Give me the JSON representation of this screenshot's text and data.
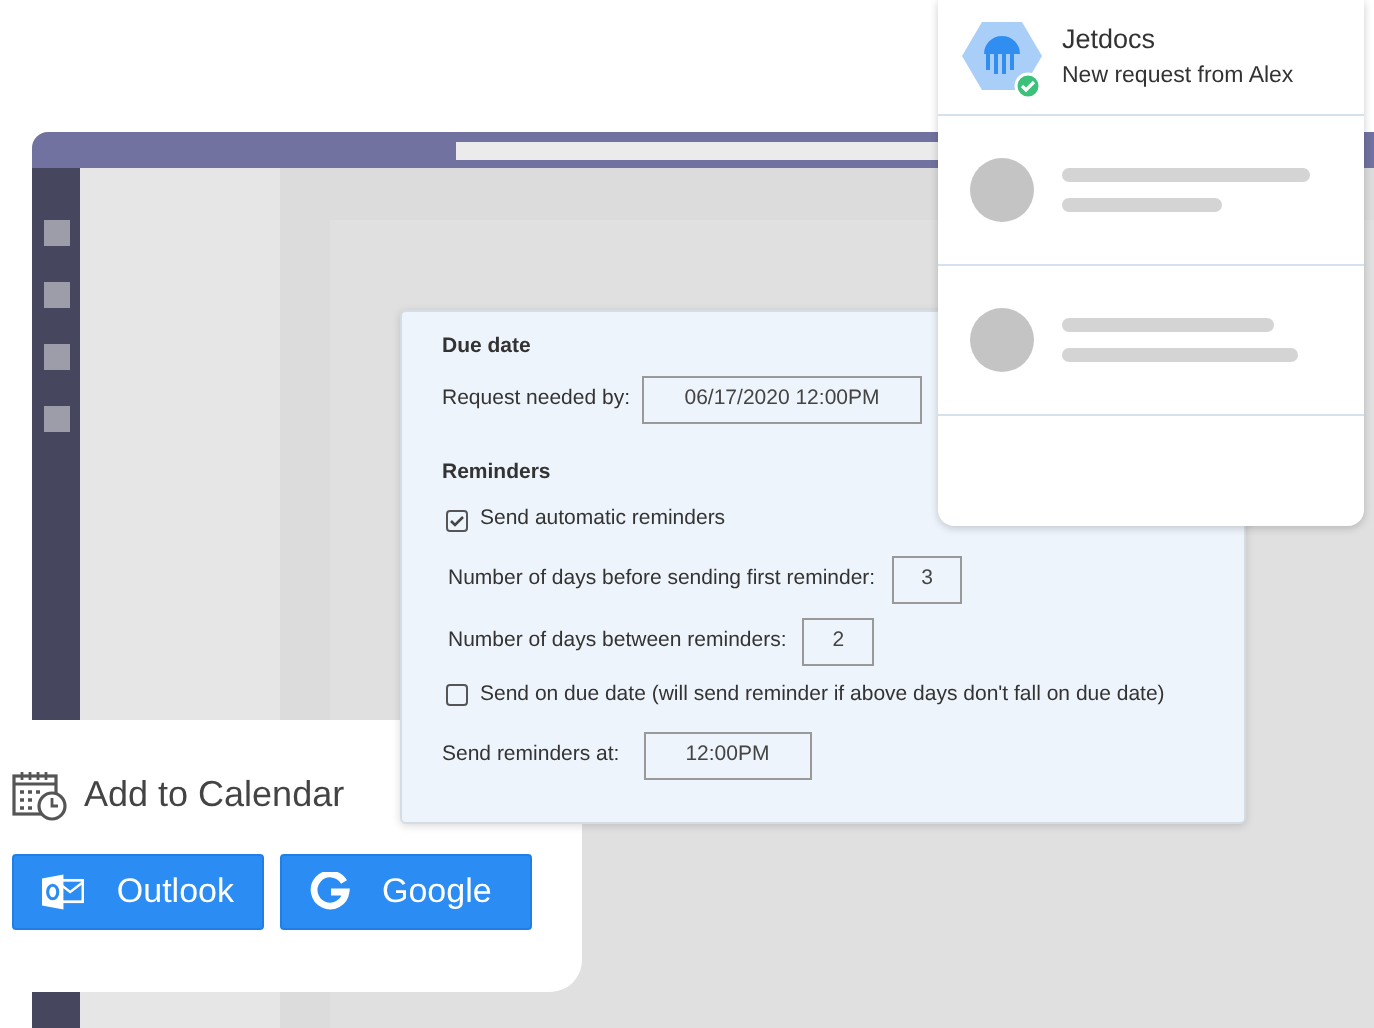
{
  "notification": {
    "app": "Jetdocs",
    "message": "New request from Alex"
  },
  "form": {
    "due_date": {
      "heading": "Due date",
      "label": "Request needed by:",
      "value": "06/17/2020 12:00PM"
    },
    "reminders": {
      "heading": "Reminders",
      "items": [
        {
          "kind": "checkbox",
          "label": "Send automatic reminders",
          "checked": true
        },
        {
          "kind": "field",
          "label": "Number of days before sending first reminder:",
          "value": "3"
        },
        {
          "kind": "field",
          "label": "Number of days between reminders:",
          "value": "2"
        },
        {
          "kind": "checkbox",
          "label": "Send on due date (will send reminder if above days don't fall on due date)",
          "checked": false
        },
        {
          "kind": "field",
          "label": "Send reminders at:",
          "value": "12:00PM"
        }
      ]
    }
  },
  "calendar": {
    "title": "Add to Calendar",
    "buttons": [
      {
        "kind": "outlook",
        "label": "Outlook"
      },
      {
        "kind": "google",
        "label": "Google"
      }
    ]
  }
}
